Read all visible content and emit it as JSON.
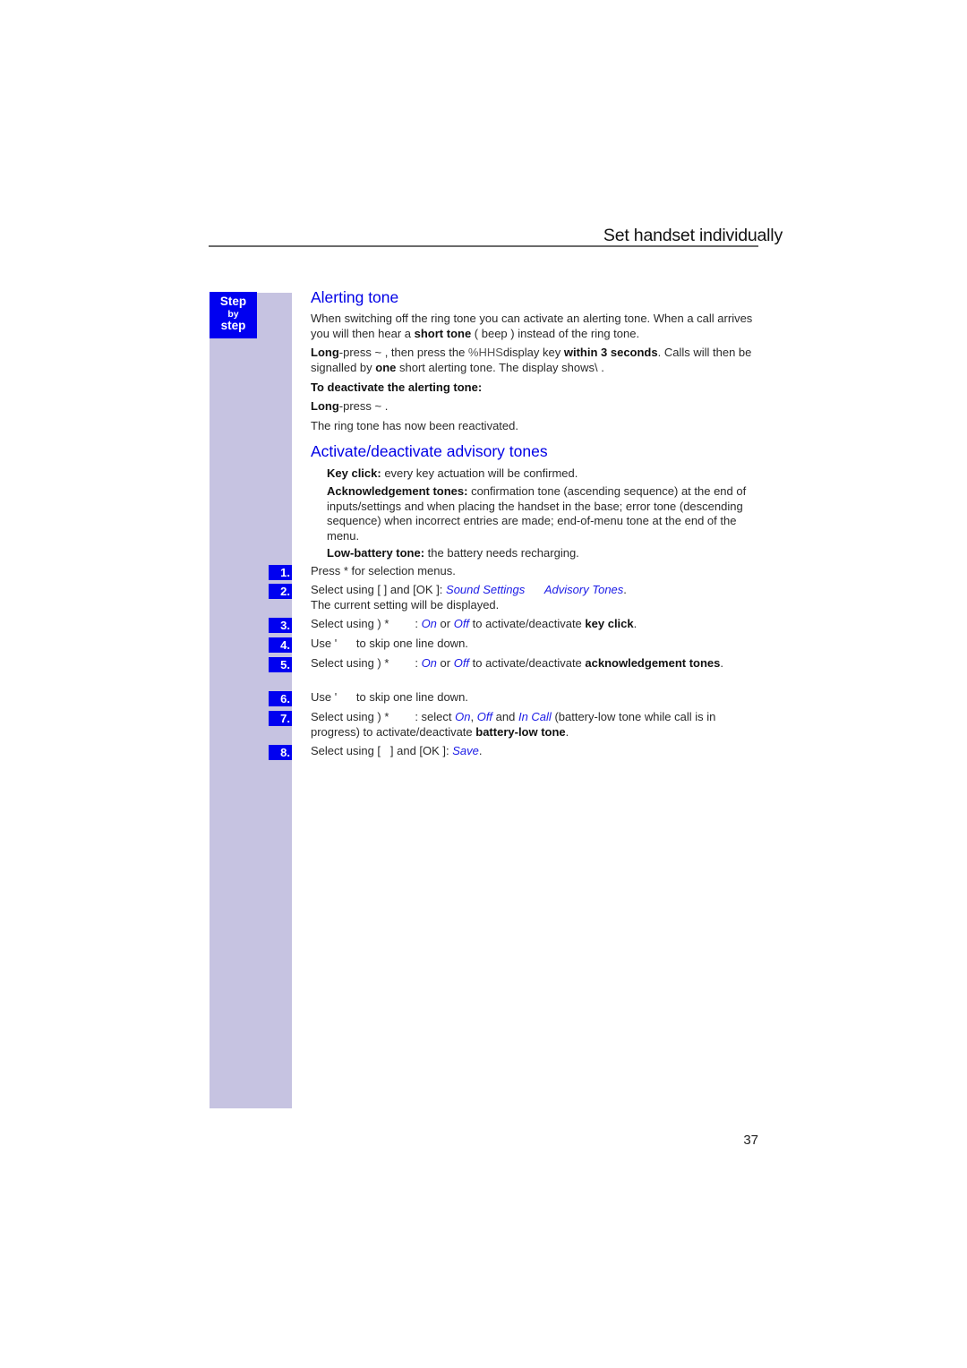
{
  "header": {
    "title": "Set handset individually"
  },
  "sidebar": {
    "badge_line1": "Step",
    "badge_line2": "by",
    "badge_line3": "step"
  },
  "sections": {
    "alerting": {
      "heading": "Alerting tone",
      "p1_a": "When switching off the ring tone you can activate an alerting tone. When a call arrives you will then hear a ",
      "p1_bold": "short tone",
      "p1_b": " (  beep  ) instead of the ring tone.",
      "p2_bold1": "Long",
      "p2_a": "-press ~     , then press the ",
      "p2_key": "%HHS",
      "p2_b": "display key ",
      "p2_bold2": "within 3 seconds",
      "p2_c": ". Calls will then be signalled by ",
      "p2_bold3": "one",
      "p2_d": " short alerting tone. The display shows\\     .",
      "deactivate_heading": "To deactivate the alerting tone:",
      "p3_bold": "Long",
      "p3_a": "-press ~     .",
      "p4": "The ring tone has now been reactivated."
    },
    "advisory": {
      "heading": "Activate/deactivate advisory tones",
      "items": [
        {
          "bold": "Key click:",
          "text": " every key actuation will be confirmed."
        },
        {
          "bold": "Acknowledgement tones:",
          "text": " confirmation tone (ascending sequence) at the end of inputs/settings and when placing the handset in the base; error tone (descending sequence) when incorrect entries are made; end-of-menu tone at the end of the menu."
        },
        {
          "bold": "Low-battery tone:",
          "text": " the battery needs recharging."
        }
      ]
    }
  },
  "steps": [
    {
      "num": "1.",
      "a": "Press *     for selection menus."
    },
    {
      "num": "2.",
      "a": "Select using [   ] and [OK ]: ",
      "i1": "Sound Settings",
      "b": "      ",
      "i2": "Advisory Tones",
      "c": ".",
      "line2": "The current setting will be displayed."
    },
    {
      "num": "3.",
      "a": "Select using ) *        : ",
      "i1": "On",
      "b": " or ",
      "i2": "Off",
      "c": " to activate/deactivate ",
      "bold": "key click",
      "d": "."
    },
    {
      "num": "4.",
      "a": "Use '      to skip one line down."
    },
    {
      "num": "5.",
      "a": "Select using ) *        : ",
      "i1": "On",
      "b": " or ",
      "i2": "Off",
      "c": " to activate/deactivate ",
      "bold": "acknowledgement tones",
      "d": "."
    },
    {
      "num": "6.",
      "a": "Use '      to skip one line down."
    },
    {
      "num": "7.",
      "a": "Select using ) *        : select ",
      "i1": "On",
      "b": ", ",
      "i2": "Off",
      "c": " and ",
      "i3": "In Call",
      "d": " (battery-low tone while call is in progress) to activate/deactivate ",
      "bold": "battery-low tone",
      "e": "."
    },
    {
      "num": "8.",
      "a": "Select using [   ] and [OK ]: ",
      "i1": "Save",
      "b": "."
    }
  ],
  "footer": {
    "page_number": "37"
  }
}
